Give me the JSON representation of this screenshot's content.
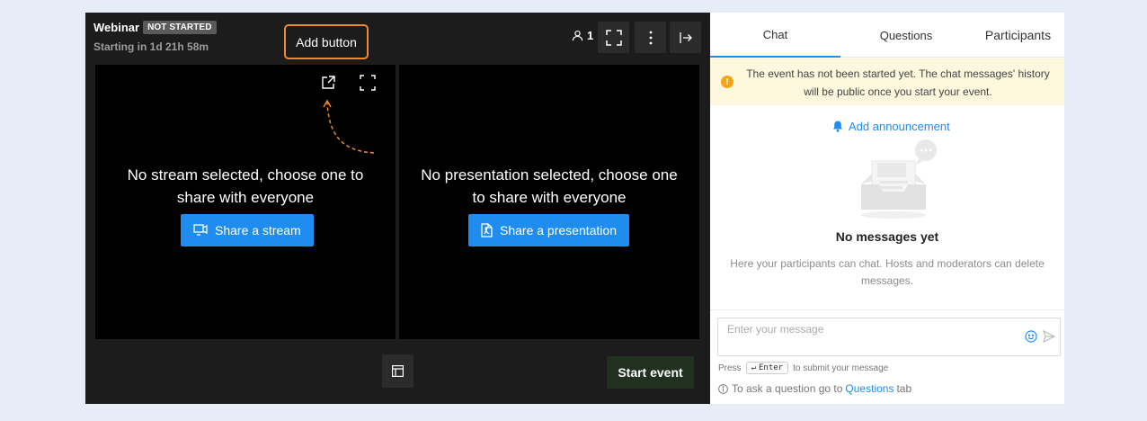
{
  "header": {
    "title": "Webinar",
    "status_badge": "NOT STARTED",
    "countdown": "Starting in 1d 21h 58m",
    "add_button_label": "Add button",
    "participant_count": "1"
  },
  "stream_panel": {
    "message": "No stream selected, choose one to share with everyone",
    "button_label": "Share a stream"
  },
  "presentation_panel": {
    "message": "No presentation selected, choose one to share with everyone",
    "button_label": "Share a presentation"
  },
  "footer": {
    "start_event_label": "Start event"
  },
  "side": {
    "tabs": [
      {
        "label": "Chat",
        "active": true
      },
      {
        "label": "Questions",
        "active": false
      },
      {
        "label": "Participants",
        "active": false
      }
    ],
    "notice": "The event has not been started yet. The chat messages' history will be public once you start your event.",
    "add_announcement": "Add announcement",
    "empty_title": "No messages yet",
    "empty_subtitle": "Here your participants can chat. Hosts and moderators can delete messages.",
    "input_placeholder": "Enter your message",
    "hint_press": "Press",
    "hint_key": "Enter",
    "hint_suffix": "to submit your message",
    "question_hint_prefix": "To ask a question go to",
    "question_hint_link": "Questions",
    "question_hint_suffix": "tab"
  },
  "colors": {
    "accent": "#1f8cf0",
    "stage_bg": "#1c1c1c",
    "start_button_bg": "#20321f",
    "highlight_border": "#ee8a2c",
    "notice_bg": "#fdf7de",
    "warning_icon": "#f2a516"
  },
  "icons": [
    "user-icon",
    "fullscreen-icon",
    "more-vertical-icon",
    "exit-icon",
    "external-link-icon",
    "expand-icon",
    "monitor-share-icon",
    "pdf-file-icon",
    "layout-icon",
    "bell-icon",
    "warning-icon",
    "emoji-icon",
    "send-icon",
    "info-icon",
    "enter-key-icon"
  ]
}
